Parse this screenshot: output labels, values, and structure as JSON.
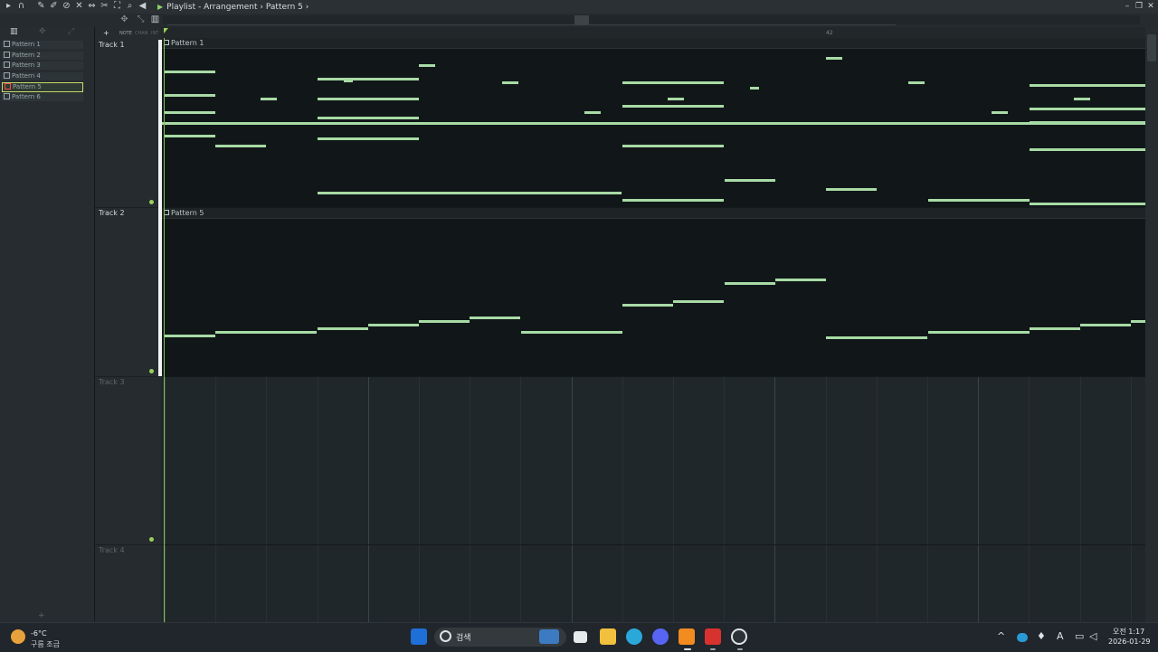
{
  "window": {
    "title": "Playlist - Arrangement",
    "pattern": "Pattern 5",
    "separator": "›"
  },
  "toolbar": {
    "labels": [
      "NOTE",
      "CHAN",
      "INT"
    ]
  },
  "picker": {
    "patterns": [
      {
        "label": "Pattern 1",
        "selected": false
      },
      {
        "label": "Pattern 2",
        "selected": false
      },
      {
        "label": "Pattern 3",
        "selected": false
      },
      {
        "label": "Pattern 4",
        "selected": false
      },
      {
        "label": "Pattern 5",
        "selected": true
      },
      {
        "label": "Pattern 6",
        "selected": false
      }
    ],
    "add_label": "+"
  },
  "ruler": {
    "marker": "42"
  },
  "tracks": [
    {
      "label": "Track 1",
      "clip": "Pattern 1"
    },
    {
      "label": "Track 2",
      "clip": "Pattern 5"
    },
    {
      "label": "Track 3"
    },
    {
      "label": "Track 4"
    }
  ],
  "taskbar": {
    "temp": "-6°C",
    "weather": "구름 조금",
    "search_placeholder": "검색",
    "time": "오전 1:17",
    "date": "2026-01-29",
    "ime": "A"
  },
  "colors": {
    "note": "#a8dba5",
    "accent": "#9ccf5a",
    "selected_outline": "#c9dc6a",
    "clip_bg": "#111719"
  }
}
